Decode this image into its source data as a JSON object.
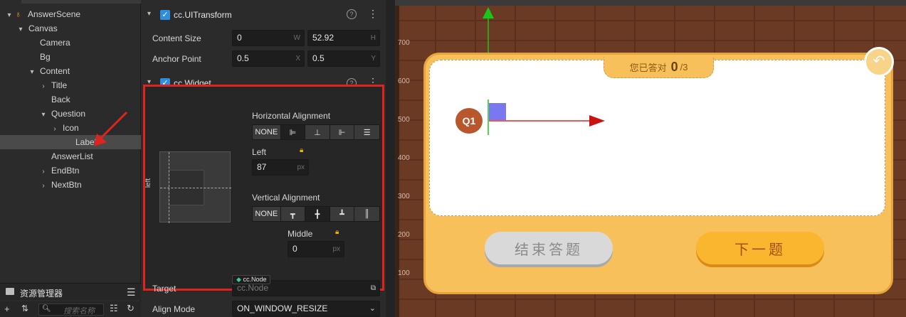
{
  "hierarchy": {
    "items": [
      {
        "label": "AnswerScene",
        "indent": 0,
        "arrow": "▾",
        "icon": "flame"
      },
      {
        "label": "Canvas",
        "indent": 1,
        "arrow": "▾"
      },
      {
        "label": "Camera",
        "indent": 2,
        "arrow": ""
      },
      {
        "label": "Bg",
        "indent": 2,
        "arrow": ""
      },
      {
        "label": "Content",
        "indent": 2,
        "arrow": "▾"
      },
      {
        "label": "Title",
        "indent": 3,
        "arrow": "›"
      },
      {
        "label": "Back",
        "indent": 3,
        "arrow": ""
      },
      {
        "label": "Question",
        "indent": 3,
        "arrow": "▾"
      },
      {
        "label": "Icon",
        "indent": 4,
        "arrow": "›"
      },
      {
        "label": "Label",
        "indent": 4,
        "arrow": "",
        "selected": true
      },
      {
        "label": "AnswerList",
        "indent": 3,
        "arrow": ""
      },
      {
        "label": "EndBtn",
        "indent": 3,
        "arrow": "›"
      },
      {
        "label": "NextBtn",
        "indent": 3,
        "arrow": "›"
      }
    ],
    "assets_title": "资源管理器",
    "search_placeholder": "搜索名称"
  },
  "inspector": {
    "uitransform": {
      "title": "cc.UITransform",
      "content_size_label": "Content Size",
      "w": "0",
      "w_sfx": "W",
      "h": "52.92",
      "h_sfx": "H",
      "anchor_label": "Anchor Point",
      "ax": "0.5",
      "ax_sfx": "X",
      "ay": "0.5",
      "ay_sfx": "Y"
    },
    "widget": {
      "title": "cc.Widget",
      "h_align_label": "Horizontal Alignment",
      "none": "NONE",
      "left_label": "Left",
      "left_value": "87",
      "px": "px",
      "v_align_label": "Vertical Alignment",
      "middle_label": "Middle",
      "middle_value": "0",
      "side_label": "left"
    },
    "target_label": "Target",
    "target_tag": "cc.Node",
    "target_value": "cc.Node",
    "align_mode_label": "Align Mode",
    "align_mode_value": "ON_WINDOW_RESIZE"
  },
  "scene": {
    "ruler": [
      "700",
      "600",
      "500",
      "400",
      "300",
      "200",
      "100"
    ],
    "answered_label": "您已答对",
    "answered_count": "0",
    "answered_total": "/3",
    "q_badge": "Q1",
    "end_button": "结束答题",
    "next_button": "下一题"
  },
  "colors": {
    "highlight": "#e0231f",
    "accent": "#2f8fdd",
    "card": "#f7c05a",
    "q_badge": "#b8572c"
  }
}
